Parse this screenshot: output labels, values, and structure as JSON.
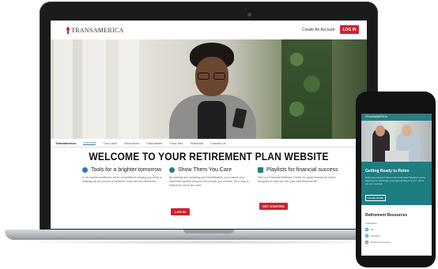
{
  "site": {
    "brand": "TRANSAMERICA",
    "create_account": "Create An Account",
    "login_label": "LOG IN"
  },
  "tabs": [
    {
      "label": "Transamerica",
      "state": "brand"
    },
    {
      "label": "Overview",
      "state": "active"
    },
    {
      "label": "Tool Links",
      "state": "normal"
    },
    {
      "label": "Resources",
      "state": "normal"
    },
    {
      "label": "Calculators",
      "state": "normal"
    },
    {
      "label": "Fund Info",
      "state": "normal"
    },
    {
      "label": "Schedule",
      "state": "normal"
    },
    {
      "label": "Contact Us",
      "state": "normal"
    }
  ],
  "main": {
    "headline": "WELCOME TO YOUR RETIREMENT PLAN WEBSITE",
    "columns": [
      {
        "icon": "lightbulb-icon",
        "title": "Tools for a brighter tomorrow",
        "body": "In all market conditions, we're committed to helping you build a strategy as you pursue a healthier, more secure retirement."
      },
      {
        "icon": "heart-icon",
        "title": "Show Them You Care",
        "body": "By naming and updating your beneficiaries, you ensure your retirement assets will go to the people you choose. It's a way to show how much you care.",
        "button": "LOG IN"
      },
      {
        "icon": "playlist-icon",
        "title": "Playlists for financial success",
        "body": "Visit our Financial Wellness Center for quick lessons on topics designed to help you live your best financial life.",
        "button": "GET STARTED"
      }
    ]
  },
  "phone": {
    "top_label": "TRANSAMERICA",
    "hero_title": "Getting Ready to Retire",
    "hero_body": "Retirement doesn't have to be a big leap! Whether you're planning for retirement, just approaching it or in it, we've got you covered.",
    "hero_button": "LEARN MORE",
    "resources_title": "Retirement Resources",
    "resources_sub": "Calculators",
    "resources_items": [
      "All",
      "Investing",
      "Retirement Income"
    ]
  },
  "colors": {
    "accent_red": "#d0202e",
    "teal": "#1e7d80",
    "link_blue": "#2d7bb5"
  }
}
